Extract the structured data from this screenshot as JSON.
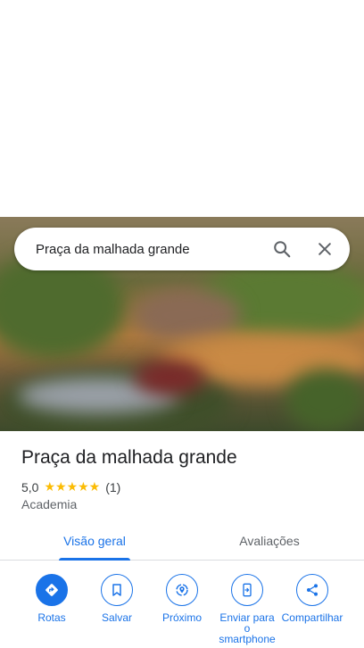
{
  "search": {
    "query": "Praça da malhada grande"
  },
  "place": {
    "name": "Praça da malhada grande",
    "rating": "5,0",
    "stars": "★★★★★",
    "review_count": "(1)",
    "category": "Academia"
  },
  "tabs": [
    {
      "label": "Visão geral",
      "active": true
    },
    {
      "label": "Avaliações",
      "active": false
    }
  ],
  "actions": [
    {
      "label": "Rotas",
      "icon": "directions-icon"
    },
    {
      "label": "Salvar",
      "icon": "bookmark-icon"
    },
    {
      "label": "Próximo",
      "icon": "nearby-icon"
    },
    {
      "label": "Enviar para o smartphone",
      "icon": "send-to-phone-icon"
    },
    {
      "label": "Compartilhar",
      "icon": "share-icon"
    }
  ],
  "colors": {
    "accent": "#1a73e8",
    "star": "#fbbc04"
  }
}
